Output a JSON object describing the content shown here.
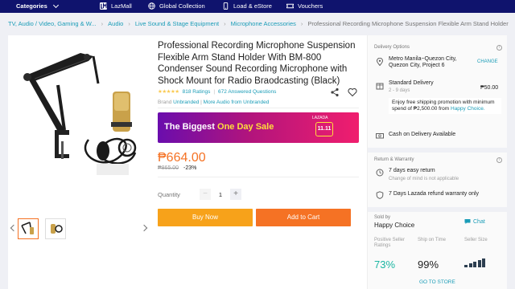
{
  "topnav": {
    "categories": "Categories",
    "lazmall": "LazMall",
    "global": "Global Collection",
    "load": "Load & eStore",
    "vouchers": "Vouchers"
  },
  "breadcrumb": [
    "TV, Audio / Video, Gaming & W...",
    "Audio",
    "Live Sound & Stage Equipment",
    "Microphone Accessories",
    "Professional Recording Microphone Suspension Flexible Arm Stand Holder"
  ],
  "product": {
    "title": "Professional Recording Microphone Suspension Flexible Arm Stand Holder With BM-800 Condenser Sound Recording Microphone with Shock Mount for Radio Braodcasting (Black)",
    "stars": "★★★★★",
    "ratings": "818 Ratings",
    "answered": "672 Answered Questions",
    "brand_label": "Brand",
    "brand": "Unbranded",
    "more_from": "More Audio from Unbranded",
    "banner_text_white": "The Biggest ",
    "banner_text_yellow": "One Day Sale",
    "banner_logo": "LAZADA",
    "banner_badge": "11.11",
    "price": "₱664.00",
    "old_price": "₱865.00",
    "discount": "-23%",
    "quantity_label": "Quantity",
    "quantity": "1",
    "minus": "−",
    "plus": "+",
    "buy_now": "Buy Now",
    "add_to_cart": "Add to Cart"
  },
  "delivery": {
    "section": "Delivery Options",
    "location": "Metro Manila~Quezon City, Quezon City, Project 6",
    "change": "CHANGE",
    "standard": "Standard Delivery",
    "days": "2 - 9 days",
    "fee": "₱50.00",
    "promo": "Enjoy free shipping promotion with minimum spend of ₱2,500.00 from",
    "promo_link": "Happy Choice.",
    "cod": "Cash on Delivery Available"
  },
  "warranty": {
    "section": "Return & Warranty",
    "easy_return": "7 days easy return",
    "easy_return_sub": "Change of mind is not applicable",
    "refund": "7 Days Lazada refund warranty only"
  },
  "seller": {
    "sold_by": "Sold by",
    "name": "Happy Choice",
    "chat": "Chat",
    "positive_label": "Positive Seller Ratings",
    "positive_value": "73%",
    "ship_label": "Ship on Time",
    "ship_value": "99%",
    "size_label": "Seller Size",
    "size_level": 5,
    "go_store": "GO TO STORE"
  },
  "colors": {
    "nav": "#0f136d",
    "accent": "#f57224",
    "buy": "#f7a21a",
    "link": "#1a9cb7",
    "positive": "#1bb6a2"
  }
}
